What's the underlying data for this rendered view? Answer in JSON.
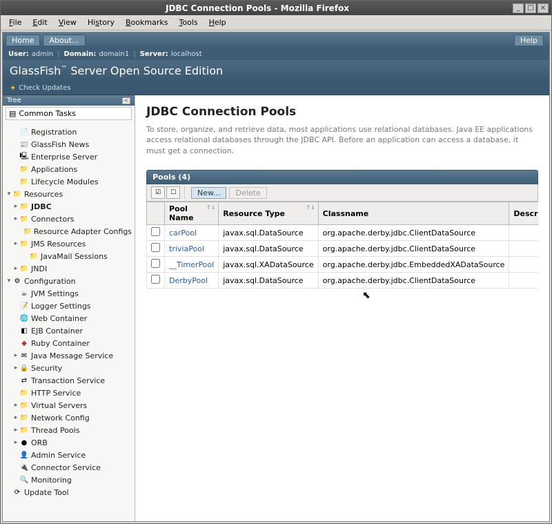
{
  "window": {
    "title": "JDBC Connection Pools - Mozilla Firefox"
  },
  "menubar": [
    "File",
    "Edit",
    "View",
    "History",
    "Bookmarks",
    "Tools",
    "Help"
  ],
  "topbar": {
    "home": "Home",
    "about": "About...",
    "help": "Help"
  },
  "infobar": {
    "userLabel": "User:",
    "userVal": "admin",
    "domainLabel": "Domain:",
    "domainVal": "domain1",
    "serverLabel": "Server:",
    "serverVal": "localhost"
  },
  "brand": {
    "product": "GlassFish",
    "tm": "™",
    "rest": " Server Open Source Edition"
  },
  "checkUpdates": "Check Updates",
  "sidebar": {
    "header": "Tree",
    "commonTasks": "Common Tasks",
    "items": [
      {
        "label": "Registration",
        "icon": "ic-doc",
        "indent": 1
      },
      {
        "label": "GlassFish News",
        "icon": "ic-news",
        "indent": 1
      },
      {
        "label": "Enterprise Server",
        "icon": "ic-server",
        "indent": 1
      },
      {
        "label": "Applications",
        "icon": "ic-folder",
        "indent": 1
      },
      {
        "label": "Lifecycle Modules",
        "icon": "ic-folder",
        "indent": 1
      },
      {
        "label": "Resources",
        "icon": "ic-folder",
        "indent": 0,
        "arrow": "▾"
      },
      {
        "label": "JDBC",
        "icon": "ic-folder",
        "indent": 1,
        "arrow": "▸",
        "selected": true
      },
      {
        "label": "Connectors",
        "icon": "ic-folder",
        "indent": 1,
        "arrow": "▸"
      },
      {
        "label": "Resource Adapter Configs",
        "icon": "ic-folder",
        "indent": 2
      },
      {
        "label": "JMS Resources",
        "icon": "ic-folder",
        "indent": 1,
        "arrow": "▸"
      },
      {
        "label": "JavaMail Sessions",
        "icon": "ic-folder",
        "indent": 2
      },
      {
        "label": "JNDI",
        "icon": "ic-folder",
        "indent": 1,
        "arrow": "▸"
      },
      {
        "label": "Configuration",
        "icon": "ic-cog",
        "indent": 0,
        "arrow": "▾"
      },
      {
        "label": "JVM Settings",
        "icon": "ic-cup",
        "indent": 1
      },
      {
        "label": "Logger Settings",
        "icon": "ic-log",
        "indent": 1
      },
      {
        "label": "Web Container",
        "icon": "ic-web",
        "indent": 1
      },
      {
        "label": "EJB Container",
        "icon": "ic-bean",
        "indent": 1
      },
      {
        "label": "Ruby Container",
        "icon": "ic-ruby",
        "indent": 1
      },
      {
        "label": "Java Message Service",
        "icon": "ic-msg",
        "indent": 1,
        "arrow": "▸"
      },
      {
        "label": "Security",
        "icon": "ic-lock",
        "indent": 1,
        "arrow": "▸"
      },
      {
        "label": "Transaction Service",
        "icon": "ic-tx",
        "indent": 1
      },
      {
        "label": "HTTP Service",
        "icon": "ic-folder",
        "indent": 1
      },
      {
        "label": "Virtual Servers",
        "icon": "ic-folder",
        "indent": 1,
        "arrow": "▸"
      },
      {
        "label": "Network Config",
        "icon": "ic-folder",
        "indent": 1,
        "arrow": "▸"
      },
      {
        "label": "Thread Pools",
        "icon": "ic-folder",
        "indent": 1,
        "arrow": "▸"
      },
      {
        "label": "ORB",
        "icon": "ic-orb",
        "indent": 1,
        "arrow": "▸"
      },
      {
        "label": "Admin Service",
        "icon": "ic-admin",
        "indent": 1
      },
      {
        "label": "Connector Service",
        "icon": "ic-conn",
        "indent": 1
      },
      {
        "label": "Monitoring",
        "icon": "ic-mon",
        "indent": 1
      },
      {
        "label": "Update Tool",
        "icon": "ic-update",
        "indent": 0
      }
    ]
  },
  "content": {
    "heading": "JDBC Connection Pools",
    "desc": "To store, organize, and retrieve data, most applications use relational databases. Java EE applications access relational databases through the JDBC API. Before an application can access a database, it must get a connection.",
    "poolHeader": "Pools (4)",
    "newBtn": "New...",
    "deleteBtn": "Delete",
    "columns": [
      "Pool Name",
      "Resource Type",
      "Classname",
      "Description"
    ],
    "rows": [
      {
        "name": "carPool",
        "type": "javax.sql.DataSource",
        "class": "org.apache.derby.jdbc.ClientDataSource",
        "desc": ""
      },
      {
        "name": "triviaPool",
        "type": "javax.sql.DataSource",
        "class": "org.apache.derby.jdbc.ClientDataSource",
        "desc": ""
      },
      {
        "name": "__TimerPool",
        "type": "javax.sql.XADataSource",
        "class": "org.apache.derby.jdbc.EmbeddedXADataSource",
        "desc": ""
      },
      {
        "name": "DerbyPool",
        "type": "javax.sql.DataSource",
        "class": "org.apache.derby.jdbc.ClientDataSource",
        "desc": ""
      }
    ]
  }
}
